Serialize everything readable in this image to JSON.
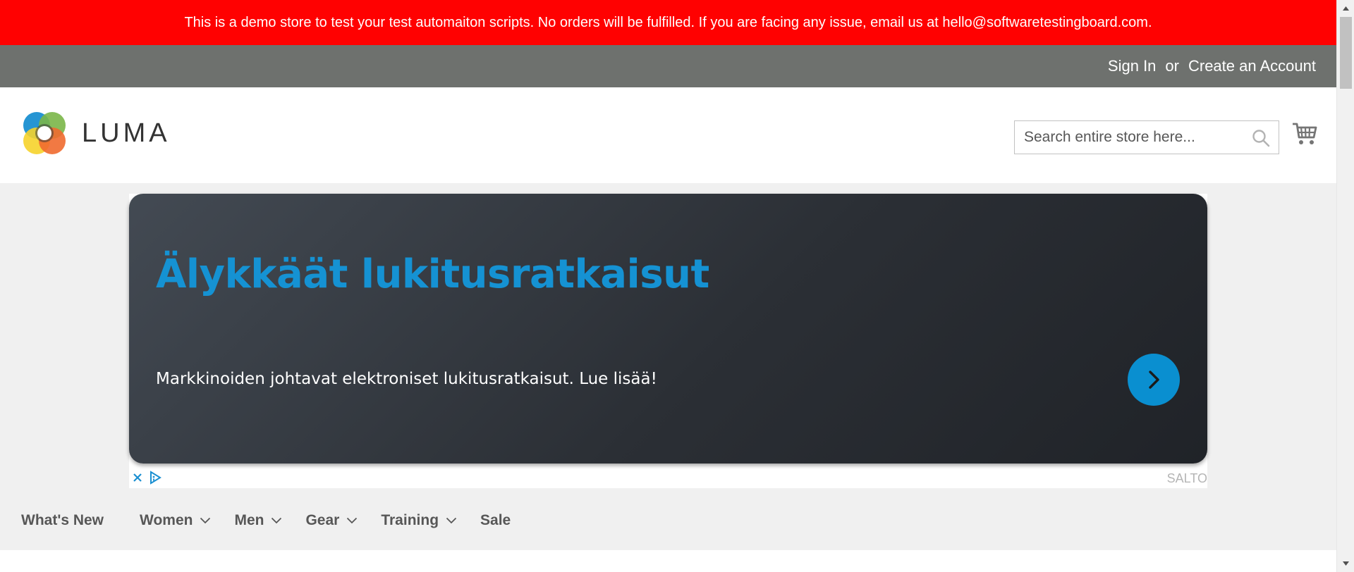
{
  "notice": {
    "text": "This is a demo store to test your test automaiton scripts. No orders will be fulfilled. If you are facing any issue, email us at hello@softwaretestingboard.com."
  },
  "panel": {
    "sign_in": "Sign In",
    "separator": "or",
    "create_account": "Create an Account"
  },
  "header": {
    "logo_text": "LUMA",
    "search_placeholder": "Search entire store here...",
    "cart_icon": "cart-icon",
    "search_icon": "magnifier-icon"
  },
  "ad": {
    "title": "Älykkäät lukitusratkaisut",
    "text": "Markkinoiden johtavat elektroniset lukitusratkaisut. Lue lisää!",
    "brand": "SALTO",
    "cta_icon": "chevron-right-icon",
    "colors": {
      "title": "#1592d3",
      "cta": "#0a8fd0"
    }
  },
  "nav": {
    "items": [
      {
        "label": "What's New",
        "has_dropdown": false
      },
      {
        "label": "Women",
        "has_dropdown": true
      },
      {
        "label": "Men",
        "has_dropdown": true
      },
      {
        "label": "Gear",
        "has_dropdown": true
      },
      {
        "label": "Training",
        "has_dropdown": true
      },
      {
        "label": "Sale",
        "has_dropdown": false
      }
    ]
  },
  "colors": {
    "notice_bg": "#ff0101",
    "panel_bg": "#6e716e",
    "nav_bg": "#f0f0f0"
  }
}
